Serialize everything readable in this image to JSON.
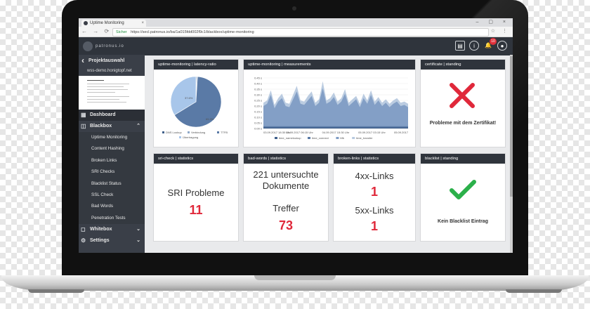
{
  "browser": {
    "tab_title": "Uptime Monitoring",
    "secure_label": "Sicher",
    "url": "https://secl.patronus.io/ba/1a015fdd002f9c1/blackbox/uptime-monitoring"
  },
  "app": {
    "brand": "patronus.io",
    "notification_count": "10"
  },
  "sidebar": {
    "project_label": "Projektauswahl",
    "project_name": "wss-demo.honigtopf.net",
    "dashboard": "Dashboard",
    "blackbox": "Blackbox",
    "blackbox_items": [
      "Uptime Monitoring",
      "Content Hashing",
      "Broken Links",
      "SRI Checks",
      "Blacklist Status",
      "SSL Check",
      "Bad Words",
      "Penetration Tests"
    ],
    "whitebox": "Whitebox",
    "settings": "Settings"
  },
  "cards": {
    "latency_title": "uptime-monitoring | latency-ratio",
    "measurements_title": "uptime-monitoring | measurements",
    "certificate_title": "certificate | standing",
    "certificate_text": "Probleme mit dem Zertifikat!",
    "sri_title": "sri-check | statistics",
    "sri_label": "SRI Probleme",
    "sri_value": "11",
    "badwords_title": "bad-words | statistics",
    "badwords_label": "221 untersuchte Dokumente",
    "badwords_hits_label": "Treffer",
    "badwords_hits_value": "73",
    "broken_title": "broken-links | statistics",
    "broken_4xx_label": "4xx-Links",
    "broken_4xx_value": "1",
    "broken_5xx_label": "5xx-Links",
    "broken_5xx_value": "1",
    "blacklist_title": "blacklist | standing",
    "blacklist_text": "Kein Blacklist Eintrag"
  },
  "colors": {
    "error_red": "#e0283a",
    "ok_green": "#2bb04a",
    "pie_dark": "#5a7aa6",
    "pie_light": "#a8c6ea"
  },
  "chart_data": [
    {
      "type": "pie",
      "title": "uptime-monitoring | latency-ratio",
      "labels": [
        "DNS Lookup",
        "Verbindung",
        "TTFB",
        "Übertragung"
      ],
      "values": [
        0.5,
        0.5,
        65.3,
        33.7
      ],
      "data_labels": [
        "37.6%",
        "65.3%"
      ]
    },
    {
      "type": "area",
      "title": "uptime-monitoring | measurements",
      "y_ticks": [
        "0.00 s",
        "0.05 s",
        "0.10 s",
        "0.15 s",
        "0.20 s",
        "0.25 s",
        "0.30 s",
        "0.35 s",
        "0.40 s",
        "0.45 s"
      ],
      "ylim": [
        0,
        0.45
      ],
      "x_ticks": [
        "03.09.2017 18:30 Uhr",
        "04.09.2017 06:15 Uhr",
        "04.09.2017 15:30 Uhr",
        "05.09.2017 03:15 Uhr",
        "05.09.2017"
      ],
      "series": [
        {
          "name": "time_namelookup",
          "values": [
            0.01,
            0.01,
            0.01,
            0.01,
            0.01,
            0.01,
            0.01,
            0.01,
            0.01,
            0.01,
            0.01,
            0.01,
            0.01,
            0.01,
            0.01,
            0.01,
            0.01,
            0.01,
            0.01,
            0.01,
            0.01,
            0.01,
            0.01,
            0.01,
            0.01,
            0.01,
            0.01,
            0.01,
            0.01,
            0.01,
            0.01,
            0.01,
            0.01,
            0.01,
            0.01,
            0.01,
            0.01,
            0.01,
            0.01,
            0.01
          ]
        },
        {
          "name": "time_connect",
          "values": [
            0.02,
            0.02,
            0.02,
            0.02,
            0.02,
            0.02,
            0.02,
            0.02,
            0.02,
            0.02,
            0.02,
            0.02,
            0.02,
            0.02,
            0.02,
            0.02,
            0.02,
            0.02,
            0.02,
            0.02,
            0.02,
            0.02,
            0.02,
            0.02,
            0.02,
            0.02,
            0.02,
            0.02,
            0.02,
            0.02,
            0.02,
            0.02,
            0.02,
            0.02,
            0.02,
            0.02,
            0.02,
            0.02,
            0.02,
            0.02
          ]
        },
        {
          "name": "ttfb",
          "values": [
            0.2,
            0.22,
            0.3,
            0.18,
            0.24,
            0.27,
            0.2,
            0.19,
            0.26,
            0.33,
            0.22,
            0.21,
            0.25,
            0.29,
            0.2,
            0.23,
            0.36,
            0.22,
            0.24,
            0.28,
            0.21,
            0.24,
            0.31,
            0.2,
            0.23,
            0.26,
            0.19,
            0.27,
            0.22,
            0.3,
            0.21,
            0.25,
            0.2,
            0.23,
            0.19,
            0.22,
            0.24,
            0.2,
            0.21,
            0.19
          ]
        },
        {
          "name": "time_transfer",
          "values": [
            0.23,
            0.25,
            0.34,
            0.21,
            0.27,
            0.31,
            0.23,
            0.22,
            0.3,
            0.38,
            0.25,
            0.24,
            0.29,
            0.33,
            0.23,
            0.26,
            0.42,
            0.25,
            0.27,
            0.32,
            0.24,
            0.27,
            0.35,
            0.23,
            0.26,
            0.29,
            0.22,
            0.31,
            0.25,
            0.34,
            0.24,
            0.28,
            0.23,
            0.26,
            0.22,
            0.25,
            0.27,
            0.23,
            0.24,
            0.22
          ]
        }
      ]
    }
  ]
}
